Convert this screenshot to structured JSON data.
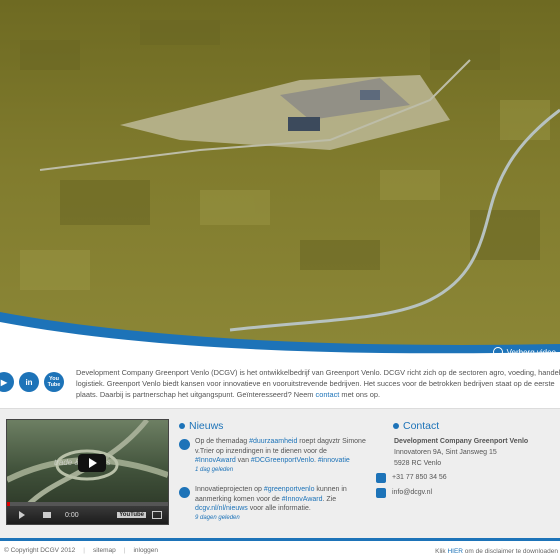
{
  "colors": {
    "accent": "#1d73b8",
    "hero_tint": "#7e7a2a",
    "band_bg": "#eeeeee"
  },
  "hero": {
    "hide_video_label": "Verberg video",
    "hide_video_icon": "magnifier-icon"
  },
  "social": [
    {
      "name": "twitter-icon"
    },
    {
      "name": "linkedin-icon",
      "label": "in"
    },
    {
      "name": "youtube-icon",
      "label": "You Tube"
    }
  ],
  "intro": {
    "line1": "Development Company Greenport Venlo (DCGV) is het ontwikkelbedrijf van Greenport Venlo. DCGV richt zich op de sectoren agro, voeding, handel e",
    "line2": "logistiek. Greenport Venlo biedt kansen voor innovatieve en vooruitstrevende bedrijven. Het succes voor de betrokken bedrijven staat op de eerste",
    "line3_pre": "plaats. Daarbij is partnerschap het uitgangspunt. Geïnteresseerd? Neem ",
    "line3_link": "contact",
    "line3_post": " met ons op."
  },
  "video": {
    "time": "0:00",
    "watermark": "trade & logistics",
    "progress": 0.02,
    "youtube_label": "YouTube"
  },
  "news": {
    "title": "Nieuws",
    "items": [
      {
        "t1": "Op de themadag ",
        "h1": "#duurzaamheid",
        "t2": " roept dagvztr Simone v.Trier op inzendingen in te dienen voor de ",
        "h2": "#InnovAward",
        "t3": " van ",
        "h3": "#DCGreenportVenlo",
        "t4": ". ",
        "h4": "#innovatie",
        "date": "1 dag geleden"
      },
      {
        "t1": "Innovatieprojecten op ",
        "h1": "#greenportvenlo",
        "t2": " kunnen in aanmerking komen voor de ",
        "h2": "#InnovAward",
        "t3": ". Zie ",
        "h3": "dcgv.nl/nl/nieuws",
        "t4": " voor alle informatie.",
        "date": "9 dagen geleden"
      }
    ]
  },
  "contact": {
    "title": "Contact",
    "company": "Development Company Greenport Venlo",
    "address1": "Innovatoren 9A, Sint Jansweg 15",
    "address2": "5928 RC Venlo",
    "phone": "+31 77 850 34 56",
    "email": "info@dcgv.nl"
  },
  "footer": {
    "copyright": "© Copyright DCGV 2012",
    "sitemap": "sitemap",
    "login": "inloggen",
    "disclaimer_pre": "Klik ",
    "disclaimer_link": "HIER",
    "disclaimer_post": " om de disclaimer te downloaden"
  }
}
